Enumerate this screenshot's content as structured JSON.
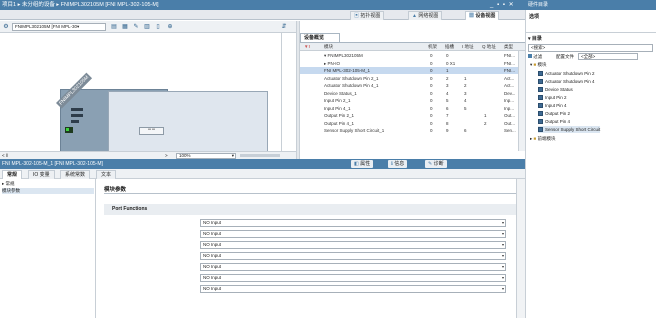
{
  "window": {
    "breadcrumb": "项目1 ▸ 未分组的设备 ▸ FNIMPL302105M [FNI MPL-302-105-M]",
    "controls": "_ ▪ ▪ ✕"
  },
  "view_tabs": [
    "拓扑视图",
    "网络视图",
    "设备视图"
  ],
  "toolbar": {
    "device_select": "FNIMPL302105M [FNI MPL-30▾"
  },
  "canvas": {
    "module_label": "FNIMPL302105M",
    "zoom": "100%",
    "scroll_left": "< ‖",
    "scroll_right": ">"
  },
  "overview": {
    "tab": "设备概览",
    "columns": [
      "模块",
      "机架",
      "插槽",
      "I 地址",
      "Q 地址",
      "类型"
    ],
    "rows": [
      {
        "module": "▾ FNIMPL302105M",
        "rack": "0",
        "slot": "0",
        "i": "",
        "q": "",
        "type": "FNI..."
      },
      {
        "module": "▸ PN-IO",
        "rack": "0",
        "slot": "0 X1",
        "i": "",
        "q": "",
        "type": "FNI..."
      },
      {
        "module": "FNI MPL-302-105-M_1",
        "rack": "0",
        "slot": "1",
        "i": "",
        "q": "",
        "type": "FNI..."
      },
      {
        "module": "Actuator Shutdown Pin 2_1",
        "rack": "0",
        "slot": "2",
        "i": "1",
        "q": "",
        "type": "Act..."
      },
      {
        "module": "Actuator Shutdown Pin 4_1",
        "rack": "0",
        "slot": "3",
        "i": "2",
        "q": "",
        "type": "Act..."
      },
      {
        "module": "Device Status_1",
        "rack": "0",
        "slot": "4",
        "i": "3",
        "q": "",
        "type": "Dev..."
      },
      {
        "module": "Input Pin 2_1",
        "rack": "0",
        "slot": "5",
        "i": "4",
        "q": "",
        "type": "Inp..."
      },
      {
        "module": "Input Pin 4_1",
        "rack": "0",
        "slot": "6",
        "i": "5",
        "q": "",
        "type": "Inp..."
      },
      {
        "module": "Output Pin 2_1",
        "rack": "0",
        "slot": "7",
        "i": "",
        "q": "1",
        "type": "Out..."
      },
      {
        "module": "Output Pin 4_1",
        "rack": "0",
        "slot": "8",
        "i": "",
        "q": "2",
        "type": "Out..."
      },
      {
        "module": "Sensor Supply Short Circuit_1",
        "rack": "0",
        "slot": "9",
        "i": "6",
        "q": "",
        "type": "Sen..."
      }
    ]
  },
  "inspector": {
    "title": "FNI MPL-302-105-M_1 [FNI MPL-302-105-M]",
    "buttons": [
      "属性",
      "信息",
      "诊断"
    ],
    "tabs": [
      "常规",
      "IO 变量",
      "系统常数",
      "文本"
    ],
    "nav": [
      "▸ 常规",
      "模块参数"
    ],
    "section": "模块参数",
    "group": "Port Functions",
    "fields": [
      {
        "label": "Function Port 0 Pin 4:",
        "value": "NO Input"
      },
      {
        "label": "Function Port 1 Pin 4:",
        "value": "NO Input"
      },
      {
        "label": "Function Port 2 Pin 4:",
        "value": "NO Input"
      },
      {
        "label": "Function Port 3 Pin 4:",
        "value": "NO Input"
      },
      {
        "label": "Function Port 4 Pin 4:",
        "value": "NO Input"
      },
      {
        "label": "Function Port 5 Pin 4:",
        "value": "NO Input"
      },
      {
        "label": "Function Port 6 Pin 4:",
        "value": "NO Input"
      }
    ]
  },
  "catalog": {
    "title": "硬件目录",
    "options": "选项",
    "section": "目录",
    "search_placeholder": "<搜索>",
    "filter_label": "过滤",
    "profile_label": "配置文件",
    "profile_value": "<全部>",
    "folder": "模块",
    "items": [
      "Actuator Shutdown Pin 2",
      "Actuator Shutdown Pin 4",
      "Device Status",
      "Input Pin 2",
      "Input Pin 4",
      "Output Pin 2",
      "Output Pin 4",
      "Sensor Supply Short Circuit"
    ],
    "front_module": "前端模块"
  }
}
